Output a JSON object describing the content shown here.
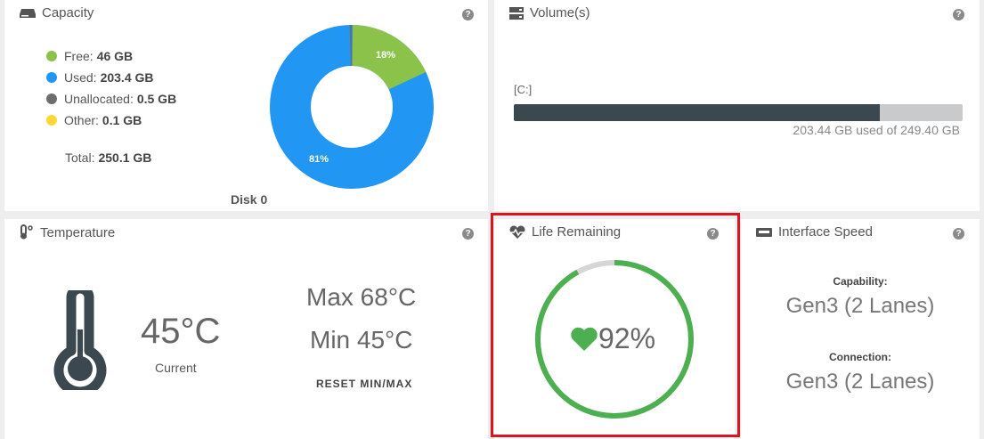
{
  "capacity": {
    "title": "Capacity",
    "help": "?",
    "legend": [
      {
        "label": "Free:",
        "value": "46 GB",
        "color": "#8bc34a"
      },
      {
        "label": "Used:",
        "value": "203.4 GB",
        "color": "#2196f3"
      },
      {
        "label": "Unallocated:",
        "value": "0.5 GB",
        "color": "#6d6d6d"
      },
      {
        "label": "Other:",
        "value": "0.1 GB",
        "color": "#fdd835"
      }
    ],
    "total_label": "Total:",
    "total_value": "250.1 GB",
    "disk_label": "Disk 0",
    "donut": {
      "free_pct": 18,
      "used_pct": 81,
      "free_label": "18%",
      "used_label": "81%"
    }
  },
  "volumes": {
    "title": "Volume(s)",
    "help": "?",
    "drive": "[C:]",
    "used_fraction": 0.8157,
    "usage_text": "203.44 GB used of 249.40 GB"
  },
  "temperature": {
    "title": "Temperature",
    "help": "?",
    "current": "45°C",
    "current_label": "Current",
    "max": "Max 68°C",
    "min": "Min 45°C",
    "reset_label": "RESET MIN/MAX"
  },
  "life": {
    "title": "Life Remaining",
    "help": "?",
    "percent_label": "92%",
    "fraction": 0.92,
    "color": "#4caf50"
  },
  "interface": {
    "title": "Interface Speed",
    "help": "?",
    "capability_label": "Capability:",
    "capability_value": "Gen3 (2 Lanes)",
    "connection_label": "Connection:",
    "connection_value": "Gen3 (2 Lanes)"
  }
}
